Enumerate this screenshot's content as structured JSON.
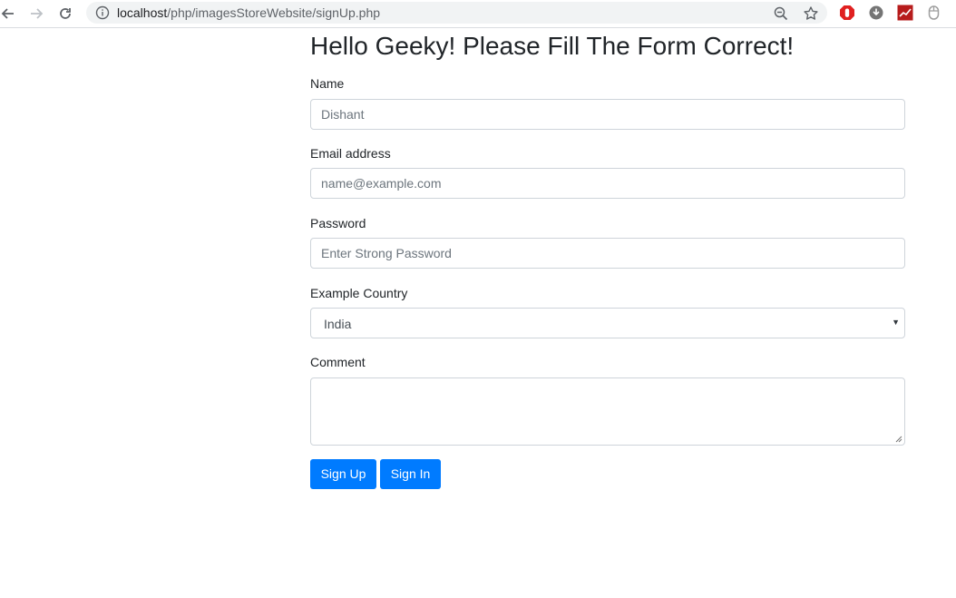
{
  "browser": {
    "url_host": "localhost",
    "url_path": "/php/imagesStoreWebsite/signUp.php"
  },
  "page": {
    "title": "Hello Geeky! Please Fill The Form Correct!"
  },
  "form": {
    "name": {
      "label": "Name",
      "placeholder": "Dishant"
    },
    "email": {
      "label": "Email address",
      "placeholder": "name@example.com"
    },
    "password": {
      "label": "Password",
      "placeholder": "Enter Strong Password"
    },
    "country": {
      "label": "Example Country",
      "selected": "India"
    },
    "comment": {
      "label": "Comment",
      "value": ""
    },
    "buttons": {
      "signup": "Sign Up",
      "signin": "Sign In"
    }
  },
  "colors": {
    "primary": "#007bff",
    "border": "#ced4da"
  },
  "icons": [
    "back-icon",
    "forward-icon",
    "reload-icon",
    "info-icon",
    "zoom-icon",
    "star-icon",
    "stop-extension-icon",
    "download-extension-icon",
    "chart-extension-icon",
    "mouse-extension-icon"
  ]
}
